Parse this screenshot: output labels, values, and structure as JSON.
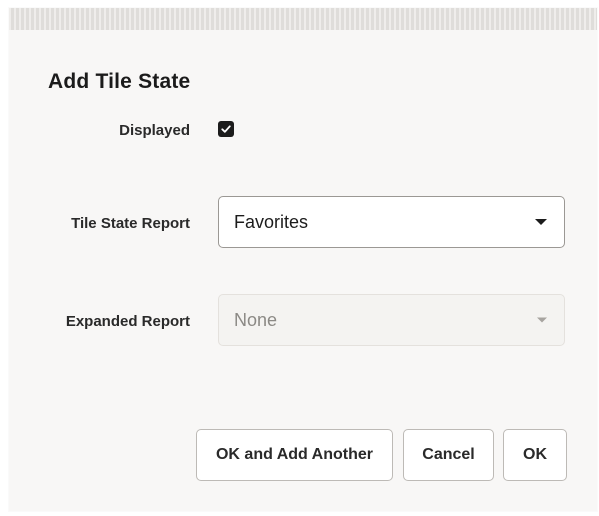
{
  "dialog": {
    "title": "Add Tile State"
  },
  "form": {
    "displayed": {
      "label": "Displayed",
      "checked": true
    },
    "tile_state_report": {
      "label": "Tile State Report",
      "value": "Favorites"
    },
    "expanded_report": {
      "label": "Expanded Report",
      "value": "None",
      "disabled": true
    }
  },
  "buttons": {
    "ok_and_add_another": "OK and Add Another",
    "cancel": "Cancel",
    "ok": "OK"
  }
}
